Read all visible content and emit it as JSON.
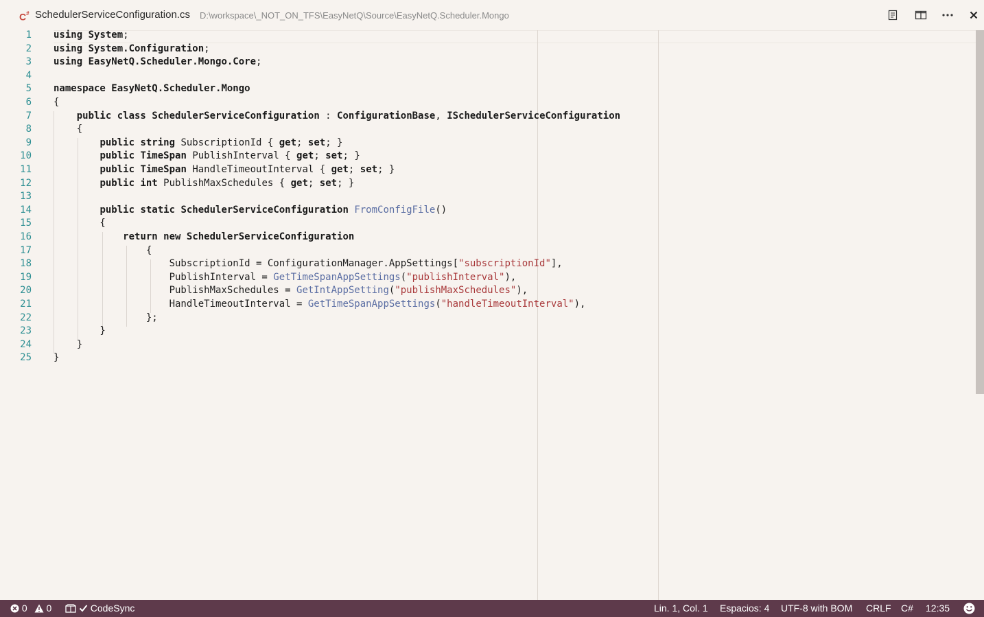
{
  "tab": {
    "file_name": "SchedulerServiceConfiguration.cs",
    "file_path": "D:\\workspace\\_NOT_ON_TFS\\EasyNetQ\\Source\\EasyNetQ.Scheduler.Mongo",
    "icon": "csharp-file-icon"
  },
  "toolbar": {
    "open_preview_icon": "open-preview-icon",
    "split_editor_icon": "split-editor-icon",
    "more_actions_icon": "more-actions-icon",
    "close_icon": "close-icon"
  },
  "editor": {
    "line_numbers": [
      "1",
      "2",
      "3",
      "4",
      "5",
      "6",
      "7",
      "8",
      "9",
      "10",
      "11",
      "12",
      "13",
      "14",
      "15",
      "16",
      "17",
      "18",
      "19",
      "20",
      "21",
      "22",
      "23",
      "24",
      "25"
    ],
    "lines": [
      [
        {
          "t": "kw",
          "v": "using"
        },
        {
          "t": "",
          "v": " "
        },
        {
          "t": "ty",
          "v": "System"
        },
        {
          "t": "",
          "v": ";"
        }
      ],
      [
        {
          "t": "kw",
          "v": "using"
        },
        {
          "t": "",
          "v": " "
        },
        {
          "t": "ty",
          "v": "System.Configuration"
        },
        {
          "t": "",
          "v": ";"
        }
      ],
      [
        {
          "t": "kw",
          "v": "using"
        },
        {
          "t": "",
          "v": " "
        },
        {
          "t": "ty",
          "v": "EasyNetQ.Scheduler.Mongo.Core"
        },
        {
          "t": "",
          "v": ";"
        }
      ],
      [],
      [
        {
          "t": "kw",
          "v": "namespace"
        },
        {
          "t": "",
          "v": " "
        },
        {
          "t": "ty",
          "v": "EasyNetQ.Scheduler.Mongo"
        }
      ],
      [
        {
          "t": "",
          "v": "{"
        }
      ],
      [
        {
          "t": "",
          "v": "    "
        },
        {
          "t": "kw",
          "v": "public class"
        },
        {
          "t": "",
          "v": " "
        },
        {
          "t": "ty",
          "v": "SchedulerServiceConfiguration"
        },
        {
          "t": "",
          "v": " : "
        },
        {
          "t": "ty",
          "v": "ConfigurationBase"
        },
        {
          "t": "",
          "v": ", "
        },
        {
          "t": "ty",
          "v": "ISchedulerServiceConfiguration"
        }
      ],
      [
        {
          "t": "",
          "v": "    {"
        }
      ],
      [
        {
          "t": "",
          "v": "        "
        },
        {
          "t": "kw",
          "v": "public string"
        },
        {
          "t": "",
          "v": " SubscriptionId { "
        },
        {
          "t": "kw",
          "v": "get"
        },
        {
          "t": "",
          "v": "; "
        },
        {
          "t": "kw",
          "v": "set"
        },
        {
          "t": "",
          "v": "; }"
        }
      ],
      [
        {
          "t": "",
          "v": "        "
        },
        {
          "t": "kw",
          "v": "public"
        },
        {
          "t": "",
          "v": " "
        },
        {
          "t": "ty",
          "v": "TimeSpan"
        },
        {
          "t": "",
          "v": " PublishInterval { "
        },
        {
          "t": "kw",
          "v": "get"
        },
        {
          "t": "",
          "v": "; "
        },
        {
          "t": "kw",
          "v": "set"
        },
        {
          "t": "",
          "v": "; }"
        }
      ],
      [
        {
          "t": "",
          "v": "        "
        },
        {
          "t": "kw",
          "v": "public"
        },
        {
          "t": "",
          "v": " "
        },
        {
          "t": "ty",
          "v": "TimeSpan"
        },
        {
          "t": "",
          "v": " HandleTimeoutInterval { "
        },
        {
          "t": "kw",
          "v": "get"
        },
        {
          "t": "",
          "v": "; "
        },
        {
          "t": "kw",
          "v": "set"
        },
        {
          "t": "",
          "v": "; }"
        }
      ],
      [
        {
          "t": "",
          "v": "        "
        },
        {
          "t": "kw",
          "v": "public int"
        },
        {
          "t": "",
          "v": " PublishMaxSchedules { "
        },
        {
          "t": "kw",
          "v": "get"
        },
        {
          "t": "",
          "v": "; "
        },
        {
          "t": "kw",
          "v": "set"
        },
        {
          "t": "",
          "v": "; }"
        }
      ],
      [],
      [
        {
          "t": "",
          "v": "        "
        },
        {
          "t": "kw",
          "v": "public static"
        },
        {
          "t": "",
          "v": " "
        },
        {
          "t": "ty",
          "v": "SchedulerServiceConfiguration"
        },
        {
          "t": "",
          "v": " "
        },
        {
          "t": "fn",
          "v": "FromConfigFile"
        },
        {
          "t": "",
          "v": "()"
        }
      ],
      [
        {
          "t": "",
          "v": "        {"
        }
      ],
      [
        {
          "t": "",
          "v": "            "
        },
        {
          "t": "kw",
          "v": "return new"
        },
        {
          "t": "",
          "v": " "
        },
        {
          "t": "ty",
          "v": "SchedulerServiceConfiguration"
        }
      ],
      [
        {
          "t": "",
          "v": "                {"
        }
      ],
      [
        {
          "t": "",
          "v": "                    SubscriptionId = ConfigurationManager.AppSettings["
        },
        {
          "t": "str",
          "v": "\"subscriptionId\""
        },
        {
          "t": "",
          "v": "],"
        }
      ],
      [
        {
          "t": "",
          "v": "                    PublishInterval = "
        },
        {
          "t": "fn",
          "v": "GetTimeSpanAppSettings"
        },
        {
          "t": "",
          "v": "("
        },
        {
          "t": "str",
          "v": "\"publishInterval\""
        },
        {
          "t": "",
          "v": "),"
        }
      ],
      [
        {
          "t": "",
          "v": "                    PublishMaxSchedules = "
        },
        {
          "t": "fn",
          "v": "GetIntAppSetting"
        },
        {
          "t": "",
          "v": "("
        },
        {
          "t": "str",
          "v": "\"publishMaxSchedules\""
        },
        {
          "t": "",
          "v": "),"
        }
      ],
      [
        {
          "t": "",
          "v": "                    HandleTimeoutInterval = "
        },
        {
          "t": "fn",
          "v": "GetTimeSpanAppSettings"
        },
        {
          "t": "",
          "v": "("
        },
        {
          "t": "str",
          "v": "\"handleTimeoutInterval\""
        },
        {
          "t": "",
          "v": "),"
        }
      ],
      [
        {
          "t": "",
          "v": "                };"
        }
      ],
      [
        {
          "t": "",
          "v": "        }"
        }
      ],
      [
        {
          "t": "",
          "v": "    }"
        }
      ],
      [
        {
          "t": "",
          "v": "}"
        }
      ]
    ]
  },
  "statusbar": {
    "errors": "0",
    "warnings": "0",
    "codesync": "CodeSync",
    "cursor_position": "Lin. 1, Col. 1",
    "indentation": "Espacios: 4",
    "encoding": "UTF-8 with BOM",
    "line_ending": "CRLF",
    "language": "C#",
    "clock": "12:35"
  },
  "colors": {
    "background": "#f7f3ef",
    "statusbar": "#5e3a4b",
    "line_number": "#2e8f93",
    "function": "#5b6ea3",
    "string": "#a8383a"
  }
}
